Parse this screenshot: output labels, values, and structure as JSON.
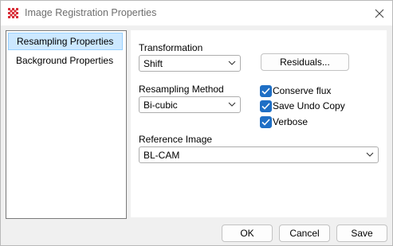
{
  "window": {
    "title": "Image Registration Properties",
    "icon": "app-grid-icon",
    "close_icon": "close-icon"
  },
  "nav": {
    "items": [
      {
        "label": "Resampling Properties",
        "selected": true
      },
      {
        "label": "Background Properties",
        "selected": false
      }
    ]
  },
  "form": {
    "transformation": {
      "label": "Transformation",
      "value": "Shift"
    },
    "residuals_label": "Residuals...",
    "resampling_method": {
      "label": "Resampling Method",
      "value": "Bi-cubic"
    },
    "checkboxes": [
      {
        "label": "Conserve flux",
        "checked": true
      },
      {
        "label": "Save Undo Copy",
        "checked": true
      },
      {
        "label": "Verbose",
        "checked": true
      }
    ],
    "reference_image": {
      "label": "Reference Image",
      "value": "BL-CAM"
    }
  },
  "footer": {
    "ok_label": "OK",
    "cancel_label": "Cancel",
    "save_label": "Save"
  },
  "colors": {
    "accent": "#1f6fc5",
    "selection_bg": "#cce8ff",
    "app_icon": "#d9303a"
  }
}
